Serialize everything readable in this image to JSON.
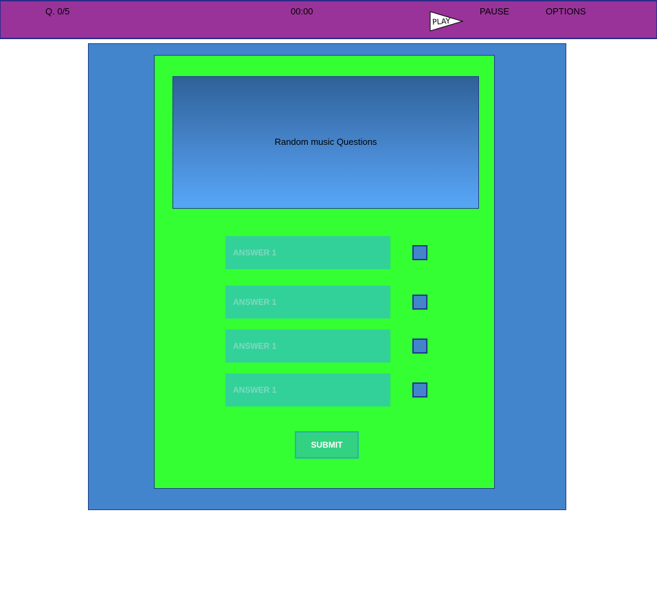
{
  "topbar": {
    "question_counter": "Q. 0/5",
    "timer": "00:00",
    "play_label": "PLAY",
    "pause_label": "PAUSE",
    "options_label": "OPTIONS"
  },
  "question": {
    "text": "Random music Questions"
  },
  "answers": [
    {
      "placeholder": "ANSWER 1"
    },
    {
      "placeholder": "ANSWER 1"
    },
    {
      "placeholder": "ANSWER 1"
    },
    {
      "placeholder": "ANSWER 1"
    }
  ],
  "submit_label": "SUBMIT",
  "colors": {
    "topbar": "#993399",
    "outer_panel": "#4285cc",
    "inner_panel": "#33ff33",
    "answer_field": "#33d19a",
    "submit_button": "#33d182",
    "border": "#1f3c88"
  }
}
